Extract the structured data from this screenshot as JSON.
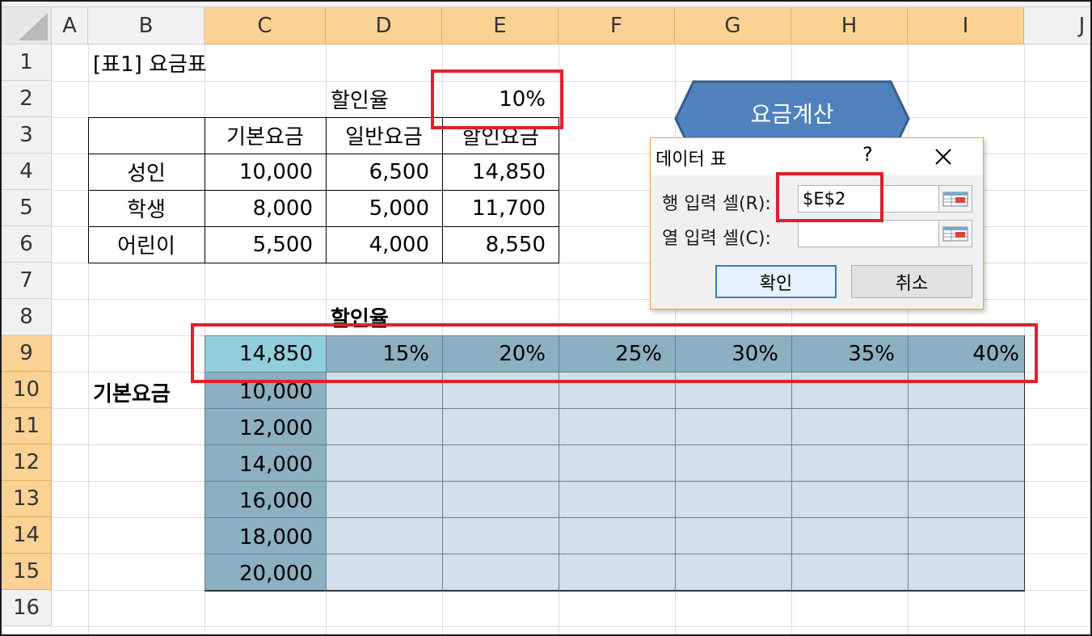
{
  "columns": [
    "A",
    "B",
    "C",
    "D",
    "E",
    "F",
    "G",
    "H",
    "I",
    "J"
  ],
  "rows": [
    "1",
    "2",
    "3",
    "4",
    "5",
    "6",
    "7",
    "8",
    "9",
    "10",
    "11",
    "12",
    "13",
    "14",
    "15",
    "16"
  ],
  "title": "[표1] 요금표",
  "discount": {
    "label": "할인율",
    "value": "10%"
  },
  "fee_table": {
    "headers": [
      "기본요금",
      "일반요금",
      "할인요금"
    ],
    "rows": [
      {
        "name": "성인",
        "base": "10,000",
        "normal": "6,500",
        "discounted": "14,850"
      },
      {
        "name": "학생",
        "base": "8,000",
        "normal": "5,000",
        "discounted": "11,700"
      },
      {
        "name": "어린이",
        "base": "5,500",
        "normal": "4,000",
        "discounted": "8,550"
      }
    ]
  },
  "data_table": {
    "row_label": "할인율",
    "col_label": "기본요금",
    "corner": "14,850",
    "rates": [
      "15%",
      "20%",
      "25%",
      "30%",
      "35%",
      "40%"
    ],
    "bases": [
      "10,000",
      "12,000",
      "14,000",
      "16,000",
      "18,000",
      "20,000"
    ]
  },
  "shape": {
    "label": "요금계산",
    "fill": "#4f81bd",
    "stroke": "#385d8a"
  },
  "dialog": {
    "title": "데이터 표",
    "help": "?",
    "row_input_label": "행 입력 셀(R):",
    "row_input_value": "$E$2",
    "col_input_label": "열 입력 셀(C):",
    "col_input_value": "",
    "ok_label": "확인",
    "cancel_label": "취소"
  },
  "colors": {
    "highlight_red": "#e0202a",
    "selected_header": "#fbd294",
    "data_fill_dark": "#8cafc1",
    "data_fill_light": "#d1dfea",
    "active_cell": "#92cddc"
  }
}
